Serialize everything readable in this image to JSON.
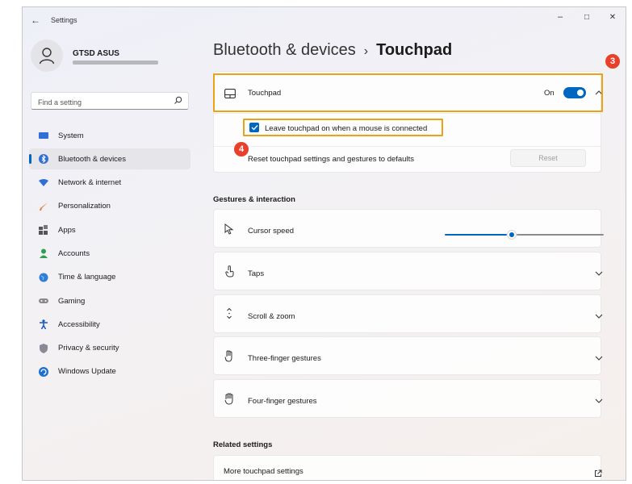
{
  "window": {
    "app_title": "Settings",
    "back_glyph": "←",
    "minimize_glyph": "–",
    "maximize_glyph": "□",
    "close_glyph": "✕"
  },
  "profile": {
    "name": "GTSD ASUS"
  },
  "search": {
    "placeholder": "Find a setting"
  },
  "sidebar": {
    "items": [
      {
        "label": "System",
        "icon": "system-icon"
      },
      {
        "label": "Bluetooth & devices",
        "icon": "bluetooth-icon",
        "selected": true
      },
      {
        "label": "Network & internet",
        "icon": "wifi-icon"
      },
      {
        "label": "Personalization",
        "icon": "brush-icon"
      },
      {
        "label": "Apps",
        "icon": "apps-icon"
      },
      {
        "label": "Accounts",
        "icon": "person-icon"
      },
      {
        "label": "Time & language",
        "icon": "globe-icon"
      },
      {
        "label": "Gaming",
        "icon": "gamepad-icon"
      },
      {
        "label": "Accessibility",
        "icon": "accessibility-icon"
      },
      {
        "label": "Privacy & security",
        "icon": "shield-icon"
      },
      {
        "label": "Windows Update",
        "icon": "update-icon"
      }
    ]
  },
  "breadcrumb": {
    "parent": "Bluetooth & devices",
    "separator": "›",
    "current": "Touchpad"
  },
  "touchpad": {
    "label": "Touchpad",
    "state_text": "On",
    "enabled": true,
    "leave_on_label": "Leave touchpad on when a mouse is connected",
    "leave_on_checked": true,
    "reset_text": "Reset touchpad settings and gestures to defaults",
    "reset_button": "Reset"
  },
  "markers": {
    "three": "3",
    "four": "4"
  },
  "gestures": {
    "title": "Gestures & interaction",
    "cursor_speed_label": "Cursor speed",
    "cursor_speed_value": 0.42,
    "items": [
      {
        "label": "Taps",
        "icon": "tap-icon"
      },
      {
        "label": "Scroll & zoom",
        "icon": "scroll-icon"
      },
      {
        "label": "Three-finger gestures",
        "icon": "three-finger-icon"
      },
      {
        "label": "Four-finger gestures",
        "icon": "four-finger-icon"
      }
    ]
  },
  "related": {
    "title": "Related settings",
    "more_touchpad": "More touchpad settings"
  },
  "colors": {
    "accent": "#0067c0",
    "highlight": "#e8a317",
    "marker": "#e8402a"
  }
}
